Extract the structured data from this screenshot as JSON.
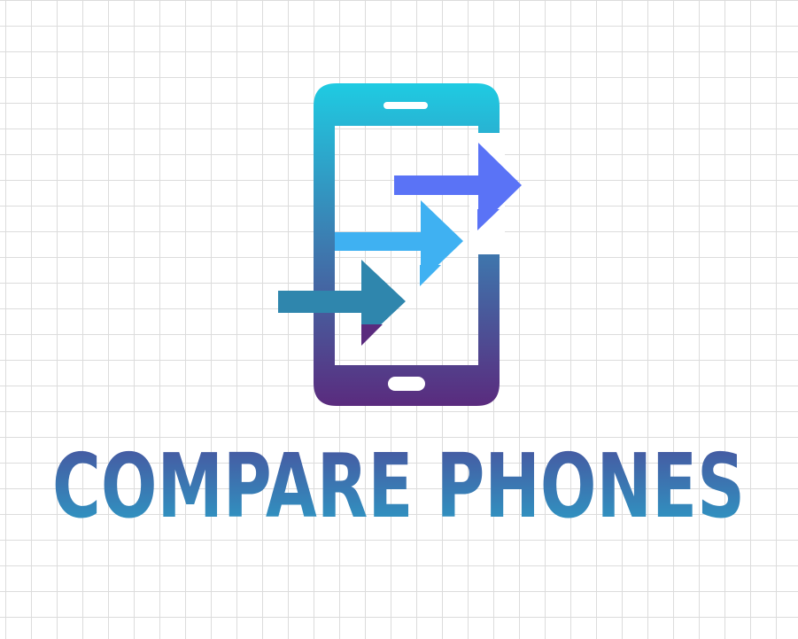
{
  "brand": {
    "title": "COMPARE PHONES",
    "gradient_top": "#4a4f9c",
    "gradient_bottom": "#2ba0c8"
  },
  "phone": {
    "gradient_top": "#1fcbe2",
    "gradient_bottom": "#5a2b7e"
  },
  "arrows": {
    "top_color": "#5a73f6",
    "middle_color": "#3fb1f2",
    "bottom_color": "#2f86ad"
  },
  "icon_names": [
    "phone-icon",
    "arrow-icon"
  ]
}
